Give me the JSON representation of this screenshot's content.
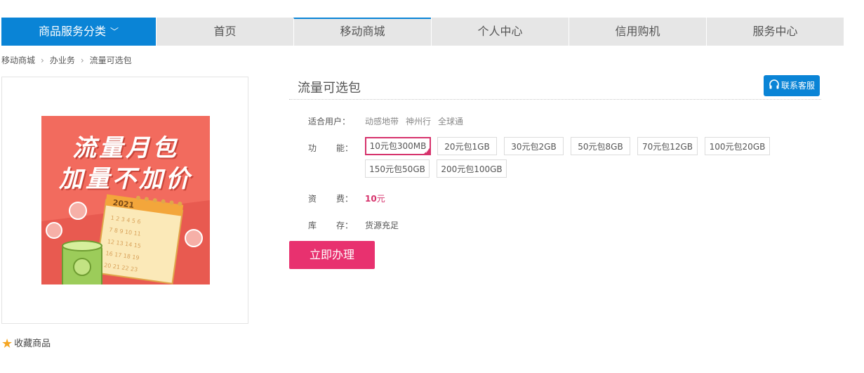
{
  "nav": {
    "category_label": "商品服务分类",
    "items": [
      "首页",
      "移动商城",
      "个人中心",
      "信用购机",
      "服务中心"
    ]
  },
  "breadcrumb": [
    "移动商城",
    "办业务",
    "流量可选包"
  ],
  "product": {
    "image_text": [
      "流量月包",
      "加量不加价"
    ],
    "image_year": "2021",
    "favorite_label": "收藏商品",
    "title": "流量可选包",
    "customer_service_label": "联系客服",
    "suitable_users_label": "适合用户：",
    "suitable_users": [
      "动感地带",
      "神州行",
      "全球通"
    ],
    "function_label_a": "功",
    "function_label_b": "能：",
    "options": [
      "10元包300MB",
      "20元包1GB",
      "30元包2GB",
      "50元包8GB",
      "70元包12GB",
      "100元包20GB",
      "150元包50GB",
      "200元包100GB"
    ],
    "selected_option": "10元包300MB",
    "fee_label_a": "资",
    "fee_label_b": "费：",
    "fee_value": "10",
    "fee_unit": "元",
    "stock_label_a": "库",
    "stock_label_b": "存：",
    "stock_value": "货源充足",
    "apply_label": "立即办理"
  },
  "colors": {
    "nav_accent": "#0a84d6",
    "price": "#d6336c",
    "apply_button": "#e8316f",
    "promo_bg": "#f26b5e"
  }
}
